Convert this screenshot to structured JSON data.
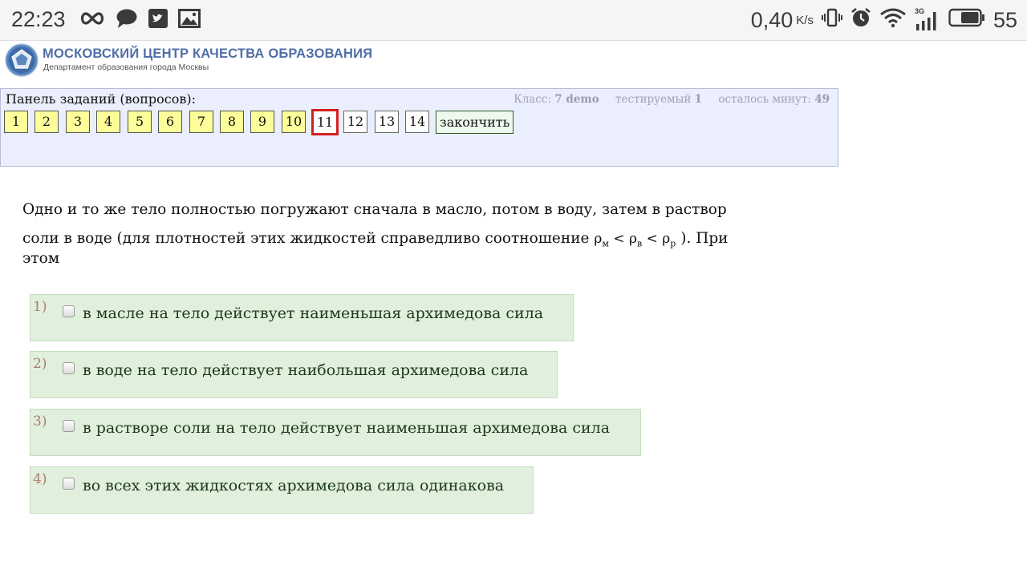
{
  "status_bar": {
    "time": "22:23",
    "speed": "0,40",
    "speed_unit": "K/s",
    "network": "3G",
    "battery": "55",
    "icons": [
      "infinity-icon",
      "chat-icon",
      "twitter-icon",
      "gallery-icon",
      "vibrate-icon",
      "alarm-icon",
      "wifi-icon",
      "signal-icon",
      "battery-icon"
    ]
  },
  "header": {
    "org_title": "МОСКОВСКИЙ ЦЕНТР КАЧЕСТВА ОБРАЗОВАНИЯ",
    "org_subtitle": "Департамент образования города Москвы"
  },
  "panel": {
    "title": "Панель заданий (вопросов):",
    "class_label": "Класс:",
    "class_value": "7 demo",
    "tested_label": "тестируемый",
    "tested_value": "1",
    "minutes_label": "осталось минут:",
    "minutes_value": "49",
    "questions": [
      "1",
      "2",
      "3",
      "4",
      "5",
      "6",
      "7",
      "8",
      "9",
      "10",
      "11",
      "12",
      "13",
      "14"
    ],
    "current": "11",
    "finish_label": "закончить"
  },
  "question": {
    "text_line1": "Одно и то же тело полностью погружают сначала в масло, потом в воду, затем в раствор",
    "text_line2": "соли в воде (для плотностей этих жидкостей справедливо соотношение",
    "rho": "ρ",
    "sub_m": "м",
    "sub_v": "в",
    "sub_p": "р",
    "lt": "<",
    "text_line2_end": "). При",
    "text_line3": "этом"
  },
  "answers": [
    {
      "num": "1)",
      "text": "в масле на тело действует наименьшая архимедова сила"
    },
    {
      "num": "2)",
      "text": "в воде на тело действует наибольшая архимедова сила"
    },
    {
      "num": "3)",
      "text": "в растворе соли на тело действует наименьшая архимедова сила"
    },
    {
      "num": "4)",
      "text": "во всех этих жидкостях архимедова сила одинакова"
    }
  ]
}
